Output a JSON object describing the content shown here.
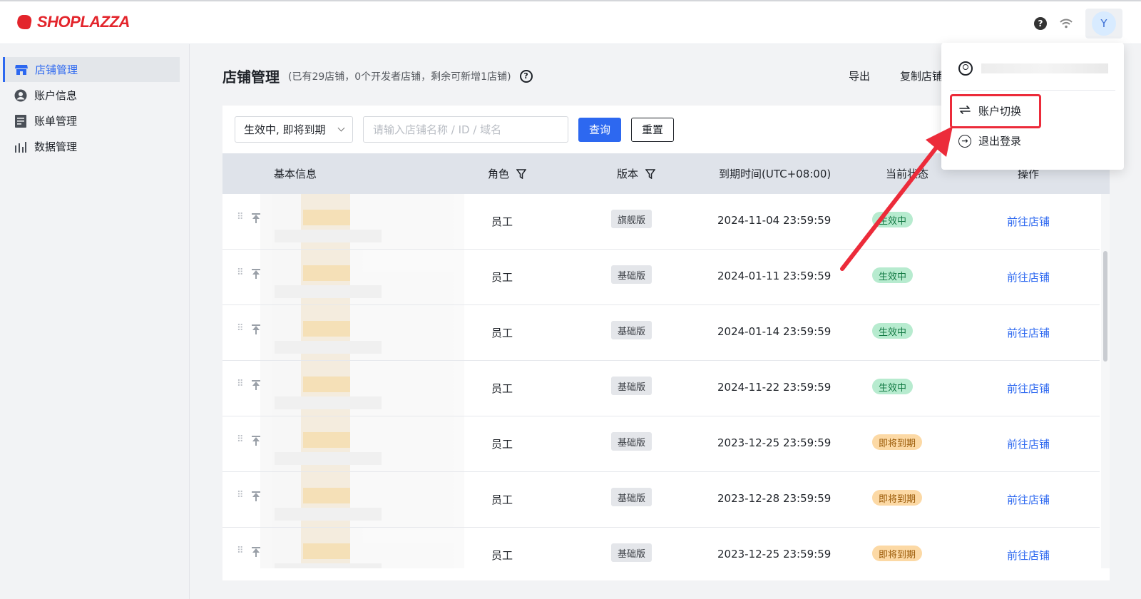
{
  "app": {
    "brand": "SHOPLAZZA",
    "brand_color": "#e3242b",
    "accent": "#2d68f0"
  },
  "topbar": {
    "help_icon": "question-circle-icon",
    "network_icon": "wifi-icon",
    "avatar_letter": "Y"
  },
  "sidebar": {
    "items": [
      {
        "label": "店铺管理",
        "icon": "store-icon",
        "active": true
      },
      {
        "label": "账户信息",
        "icon": "user-circle-icon",
        "active": false
      },
      {
        "label": "账单管理",
        "icon": "bill-icon",
        "active": false
      },
      {
        "label": "数据管理",
        "icon": "bar-chart-icon",
        "active": false
      }
    ]
  },
  "page": {
    "title": "店铺管理",
    "subtitle": "(已有29店铺，0个开发者店铺，剩余可新增1店铺)",
    "actions": {
      "export": "导出",
      "copy_store": "复制店铺"
    }
  },
  "filters": {
    "status_select": "生效中, 即将到期",
    "search_placeholder": "请输入店铺名称 / ID / 域名",
    "query_button": "查询",
    "reset_button": "重置"
  },
  "table": {
    "headers": {
      "basic_info": "基本信息",
      "role": "角色",
      "version": "版本",
      "expiry": "到期时间(UTC+08:00)",
      "status": "当前状态",
      "action": "操作"
    },
    "rows": [
      {
        "role": "员工",
        "version": "旗舰版",
        "expiry": "2024-11-04 23:59:59",
        "status": "生效中",
        "status_type": "active",
        "action": "前往店铺"
      },
      {
        "role": "员工",
        "version": "基础版",
        "expiry": "2024-01-11 23:59:59",
        "status": "生效中",
        "status_type": "active",
        "action": "前往店铺"
      },
      {
        "role": "员工",
        "version": "基础版",
        "expiry": "2024-01-14 23:59:59",
        "status": "生效中",
        "status_type": "active",
        "action": "前往店铺"
      },
      {
        "role": "员工",
        "version": "基础版",
        "expiry": "2024-11-22 23:59:59",
        "status": "生效中",
        "status_type": "active",
        "action": "前往店铺"
      },
      {
        "role": "员工",
        "version": "基础版",
        "expiry": "2023-12-25 23:59:59",
        "status": "即将到期",
        "status_type": "soon",
        "action": "前往店铺"
      },
      {
        "role": "员工",
        "version": "基础版",
        "expiry": "2023-12-28 23:59:59",
        "status": "即将到期",
        "status_type": "soon",
        "action": "前往店铺"
      },
      {
        "role": "员工",
        "version": "基础版",
        "expiry": "2023-12-25 23:59:59",
        "status": "即将到期",
        "status_type": "soon",
        "action": "前往店铺"
      }
    ]
  },
  "dropdown": {
    "switch_account": "账户切换",
    "logout": "退出登录",
    "highlight_color": "#ec2b3a"
  }
}
